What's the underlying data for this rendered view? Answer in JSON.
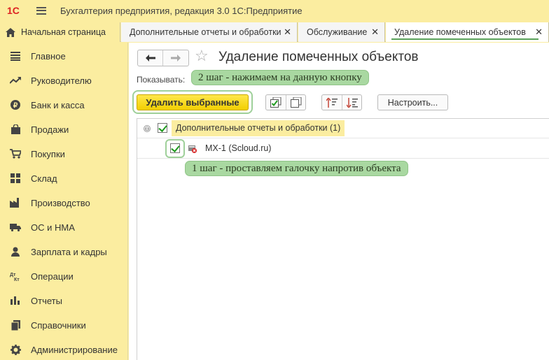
{
  "app": {
    "logo_text": "1С",
    "title": "Бухгалтерия предприятия, редакция 3.0 1С:Предприятие"
  },
  "tabs": {
    "home_label": "Начальная страница",
    "items": [
      {
        "label": "Дополнительные отчеты и обработки",
        "close": "✕"
      },
      {
        "label": "Обслуживание",
        "close": "✕"
      },
      {
        "label": "Удаление помеченных объектов",
        "close": "✕"
      }
    ]
  },
  "sidebar": {
    "items": [
      {
        "label": "Главное",
        "icon": "list-icon"
      },
      {
        "label": "Руководителю",
        "icon": "trend-icon"
      },
      {
        "label": "Банк и касса",
        "icon": "ruble-icon"
      },
      {
        "label": "Продажи",
        "icon": "bag-icon"
      },
      {
        "label": "Покупки",
        "icon": "cart-icon"
      },
      {
        "label": "Склад",
        "icon": "grid-icon"
      },
      {
        "label": "Производство",
        "icon": "factory-icon"
      },
      {
        "label": "ОС и НМА",
        "icon": "truck-icon"
      },
      {
        "label": "Зарплата и кадры",
        "icon": "person-icon"
      },
      {
        "label": "Операции",
        "icon": "dt-kt-icon"
      },
      {
        "label": "Отчеты",
        "icon": "bar-chart-icon"
      },
      {
        "label": "Справочники",
        "icon": "books-icon"
      },
      {
        "label": "Администрирование",
        "icon": "gear-icon"
      }
    ]
  },
  "page": {
    "title": "Удаление помеченных объектов",
    "show_label": "Показывать:",
    "annotation_step2": "2 шаг - нажимаем на данную кнопку",
    "annotation_step1": "1 шаг - проставляем галочку напротив объекта",
    "delete_button": "Удалить выбранные",
    "setup_button": "Настроить..."
  },
  "tree": {
    "group_label": "Дополнительные отчеты и обработки (1)",
    "group_expander": "⊖",
    "object_label": "MX-1 (Scloud.ru)"
  },
  "colors": {
    "sidebar_bg": "#fbeda0",
    "accent_yellow": "#f2cf00",
    "annotation_green": "#a9d8a1",
    "check_green": "#1f9a1f"
  }
}
